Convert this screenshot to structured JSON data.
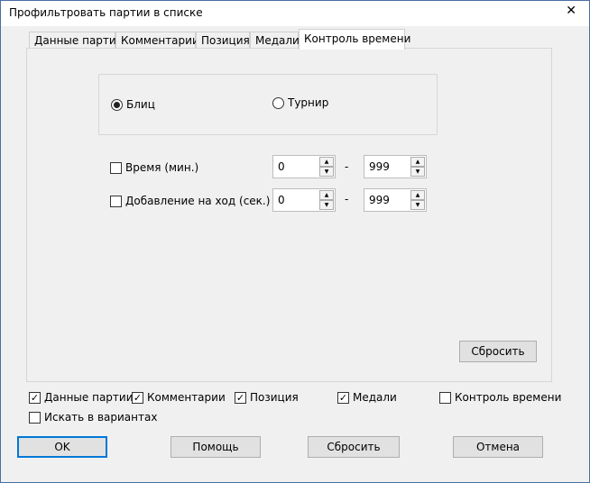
{
  "window": {
    "title": "Профильтровать партии в списке",
    "close_glyph": "✕"
  },
  "tabs": [
    {
      "label": "Данные партии"
    },
    {
      "label": "Комментарии"
    },
    {
      "label": "Позиция"
    },
    {
      "label": "Медали"
    },
    {
      "label": "Контроль времени",
      "active": true
    }
  ],
  "time_control": {
    "mode_options": [
      {
        "label": "Блиц",
        "selected": true
      },
      {
        "label": "Турнир",
        "selected": false
      }
    ],
    "time_filter": {
      "label": "Время (мин.)",
      "checked": false,
      "from": "0",
      "to": "999"
    },
    "increment_filter": {
      "label": "Добавление на ход (сек.)",
      "checked": false,
      "from": "0",
      "to": "999"
    },
    "range_separator": "-",
    "reset_label": "Сбросить"
  },
  "filters": [
    {
      "label": "Данные партии",
      "checked": true
    },
    {
      "label": "Комментарии",
      "checked": true
    },
    {
      "label": "Позиция",
      "checked": true
    },
    {
      "label": "Медали",
      "checked": true
    },
    {
      "label": "Контроль времени",
      "checked": false
    },
    {
      "label": "Искать в вариантах",
      "checked": false
    }
  ],
  "buttons": {
    "ok": "OK",
    "help": "Помощь",
    "reset": "Сбросить",
    "cancel": "Отмена"
  },
  "check_glyph": "✓"
}
